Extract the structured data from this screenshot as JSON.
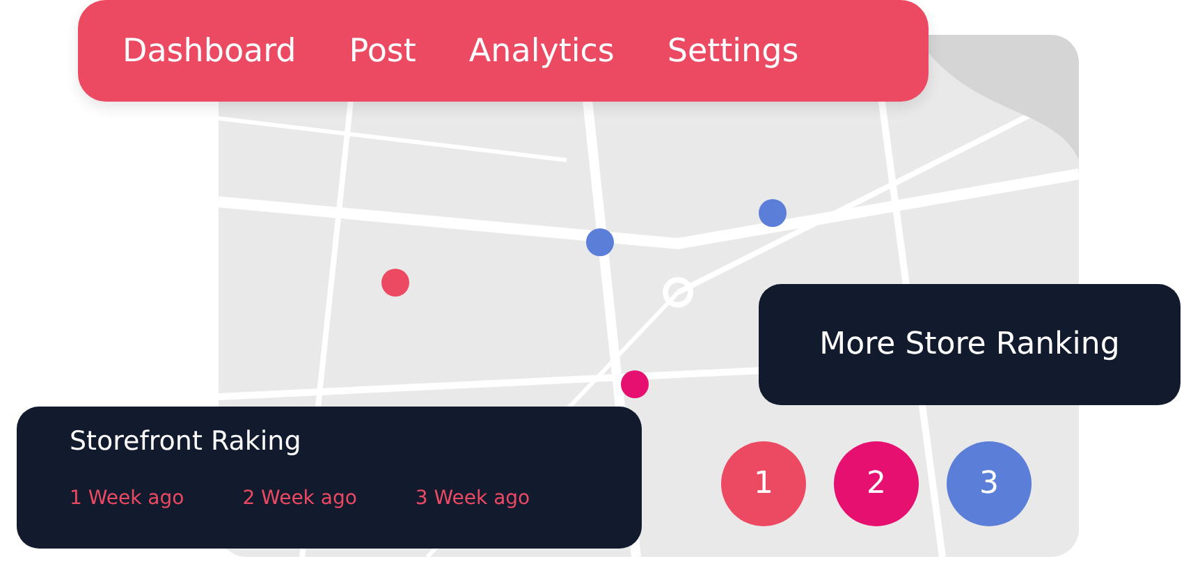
{
  "nav": {
    "items": [
      {
        "label": "Dashboard"
      },
      {
        "label": "Post"
      },
      {
        "label": "Analytics"
      },
      {
        "label": "Settings"
      }
    ]
  },
  "map": {
    "kind": "picture",
    "pins": [
      {
        "color": "#ec4a62"
      },
      {
        "color": "#5b7fd9"
      },
      {
        "color": "#5b7fd9"
      },
      {
        "color": "#e5106f"
      }
    ]
  },
  "more_card": {
    "title": "More Store Ranking"
  },
  "storefront_card": {
    "title": "Storefront Raking",
    "links": [
      {
        "label": "1 Week ago"
      },
      {
        "label": "2 Week ago"
      },
      {
        "label": "3 Week ago"
      }
    ]
  },
  "ranks": [
    {
      "label": "1",
      "color": "#ec4a62"
    },
    {
      "label": "2",
      "color": "#e5106f"
    },
    {
      "label": "3",
      "color": "#5b7fd9"
    }
  ]
}
